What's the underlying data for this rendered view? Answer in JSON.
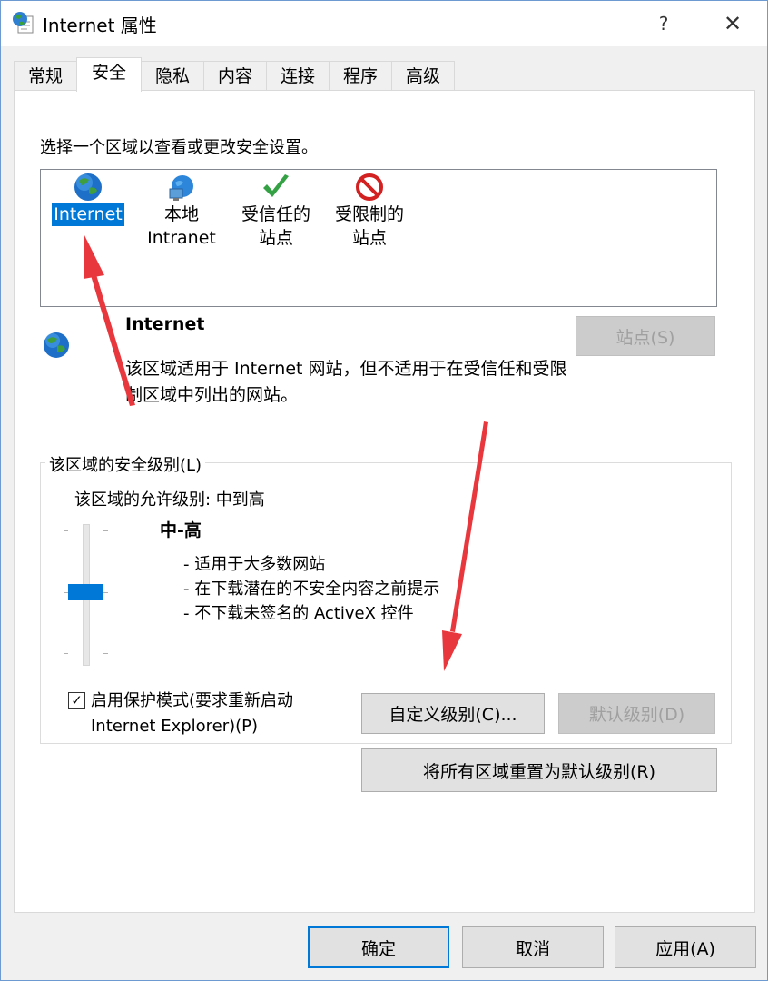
{
  "window": {
    "title": "Internet 属性",
    "help_glyph": "?",
    "close_glyph": "✕"
  },
  "tabs": [
    {
      "label": "常规"
    },
    {
      "label": "安全"
    },
    {
      "label": "隐私"
    },
    {
      "label": "内容"
    },
    {
      "label": "连接"
    },
    {
      "label": "程序"
    },
    {
      "label": "高级"
    }
  ],
  "active_tab": "安全",
  "security": {
    "zone_heading": "选择一个区域以查看或更改安全设置。",
    "zones": [
      {
        "line1": "Internet",
        "line2": "",
        "icon": "globe-icon",
        "selected": true
      },
      {
        "line1": "本地",
        "line2": "Intranet",
        "icon": "intranet-icon",
        "selected": false
      },
      {
        "line1": "受信任的",
        "line2": "站点",
        "icon": "checkmark-icon",
        "selected": false
      },
      {
        "line1": "受限制的",
        "line2": "站点",
        "icon": "restricted-icon",
        "selected": false
      }
    ],
    "info_title": "Internet",
    "info_desc": "该区域适用于 Internet 网站，但不适用于在受信任和受限制区域中列出的网站。",
    "sites_button": "站点(S)",
    "group_label": "该区域的安全级别(L)",
    "allowed_levels": "该区域的允许级别: 中到高",
    "level_title": "中-高",
    "level_desc": [
      "- 适用于大多数网站",
      "- 在下载潜在的不安全内容之前提示",
      "- 不下载未签名的 ActiveX 控件"
    ],
    "protected_mode": {
      "checked": true,
      "line1": "启用保护模式(要求重新启动",
      "line2": "Internet Explorer)(P)"
    },
    "custom_level_button": "自定义级别(C)...",
    "default_level_button": "默认级别(D)",
    "reset_all_button": "将所有区域重置为默认级别(R)"
  },
  "footer": {
    "ok": "确定",
    "cancel": "取消",
    "apply": "应用(A)"
  },
  "colors": {
    "accent": "#0078d7",
    "annotation_arrow": "#e8383d",
    "disabled_text": "#a0a0a0"
  }
}
